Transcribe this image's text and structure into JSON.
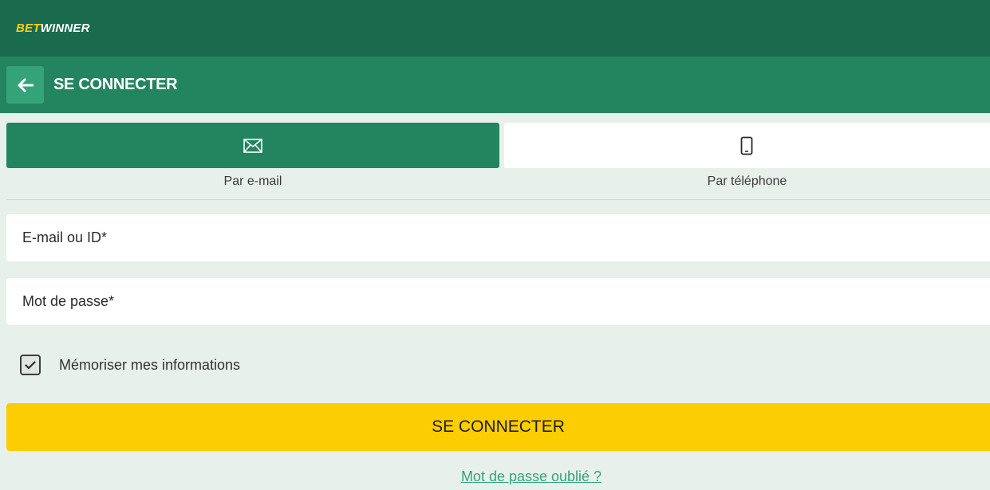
{
  "brand": {
    "logo_bet": "BET",
    "logo_winner": "WINNER",
    "primary_color": "#238460",
    "accent_color": "#fccd02"
  },
  "header": {
    "title": "SE CONNECTER",
    "back_icon": "arrow-left-icon"
  },
  "tabs": [
    {
      "label": "Par e-mail",
      "icon": "envelope-icon",
      "active": true
    },
    {
      "label": "Par téléphone",
      "icon": "smartphone-icon",
      "active": false
    }
  ],
  "form": {
    "email_placeholder": "E-mail ou ID*",
    "password_placeholder": "Mot de passe*",
    "remember_label": "Mémoriser mes informations",
    "remember_checked": true,
    "submit_label": "SE CONNECTER",
    "forgot_label": "Mot de passe oublié ?"
  }
}
